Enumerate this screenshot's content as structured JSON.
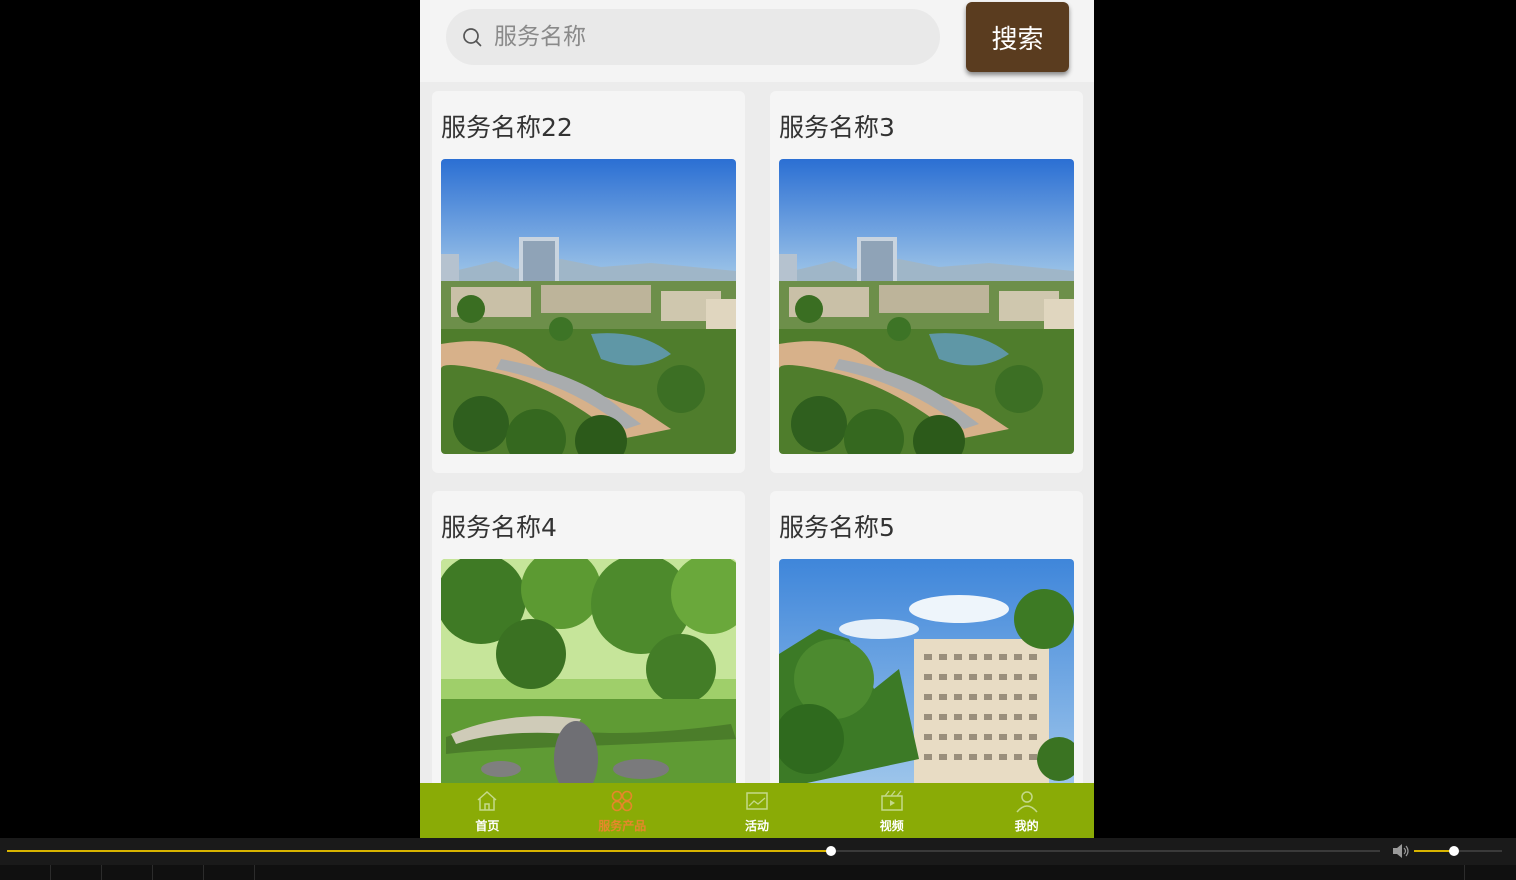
{
  "search": {
    "placeholder": "服务名称",
    "button_label": "搜索"
  },
  "services": [
    {
      "name": "服务名称22",
      "image": "campus-aerial-photo"
    },
    {
      "name": "服务名称3",
      "image": "campus-aerial-photo"
    },
    {
      "name": "服务名称4",
      "image": "garden-photo"
    },
    {
      "name": "服务名称5",
      "image": "hospital-building-photo"
    }
  ],
  "tabbar": {
    "items": [
      {
        "label": "首页",
        "icon": "home-icon",
        "active": false
      },
      {
        "label": "服务产品",
        "icon": "grid-icon",
        "active": true
      },
      {
        "label": "活动",
        "icon": "picture-icon",
        "active": false
      },
      {
        "label": "视频",
        "icon": "video-icon",
        "active": false
      },
      {
        "label": "我的",
        "icon": "user-icon",
        "active": false
      }
    ],
    "colors": {
      "background": "#8aab06",
      "active": "#e5872b",
      "inactive": "#ffffff"
    }
  },
  "player": {
    "progress": 0.6,
    "volume": 0.45
  }
}
